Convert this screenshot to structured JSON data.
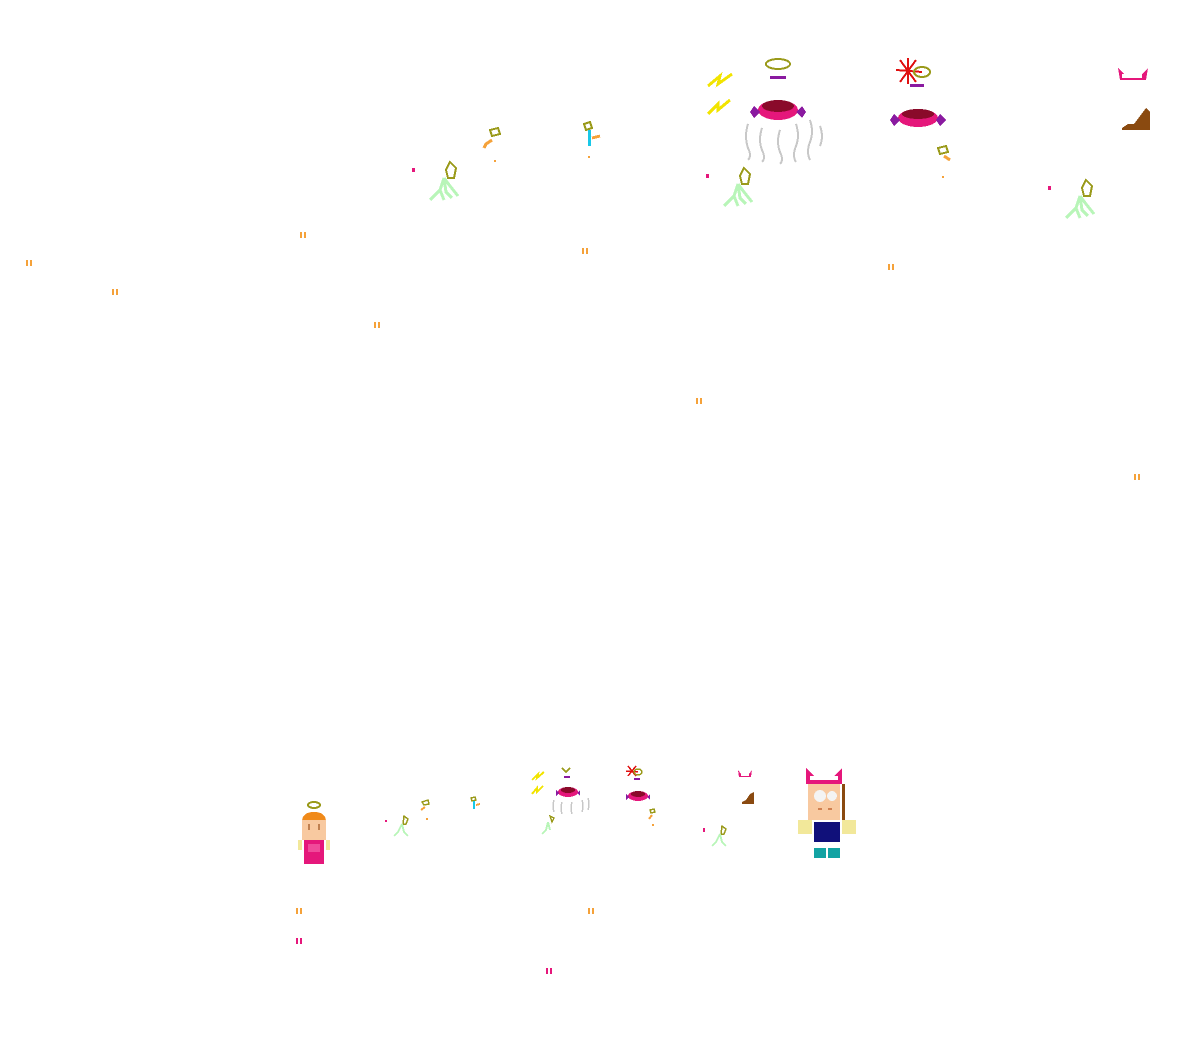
{
  "scene": {
    "title": "",
    "palette": {
      "orange": "#f5a23a",
      "magenta": "#e5177b",
      "green": "#b8f5b8",
      "olive": "#9a9a1a",
      "yellow": "#f2e400",
      "purple": "#8a1aa0",
      "crimson": "#c2124a",
      "red": "#e01010",
      "brown": "#8a4a10",
      "grey": "#c8c8c8",
      "navy": "#10107a",
      "teal": "#12a3a3",
      "skin": "#f8c9a0",
      "hair": "#f08a1a",
      "cyan": "#18c8e8"
    }
  },
  "sprites": {
    "large_row": [
      "plant-sprite",
      "seed-sprite",
      "sprout-sprite",
      "ghost-spirit-sprite",
      "angry-candy-sprite",
      "cat-ears-poop-sprite"
    ],
    "small_row": [
      "angel-girl-character",
      "plant-sprite",
      "sprout-sprite",
      "ghost-spirit-sprite",
      "angry-candy-sprite",
      "cat-ears-poop-sprite",
      "cat-hat-kid-character"
    ]
  }
}
